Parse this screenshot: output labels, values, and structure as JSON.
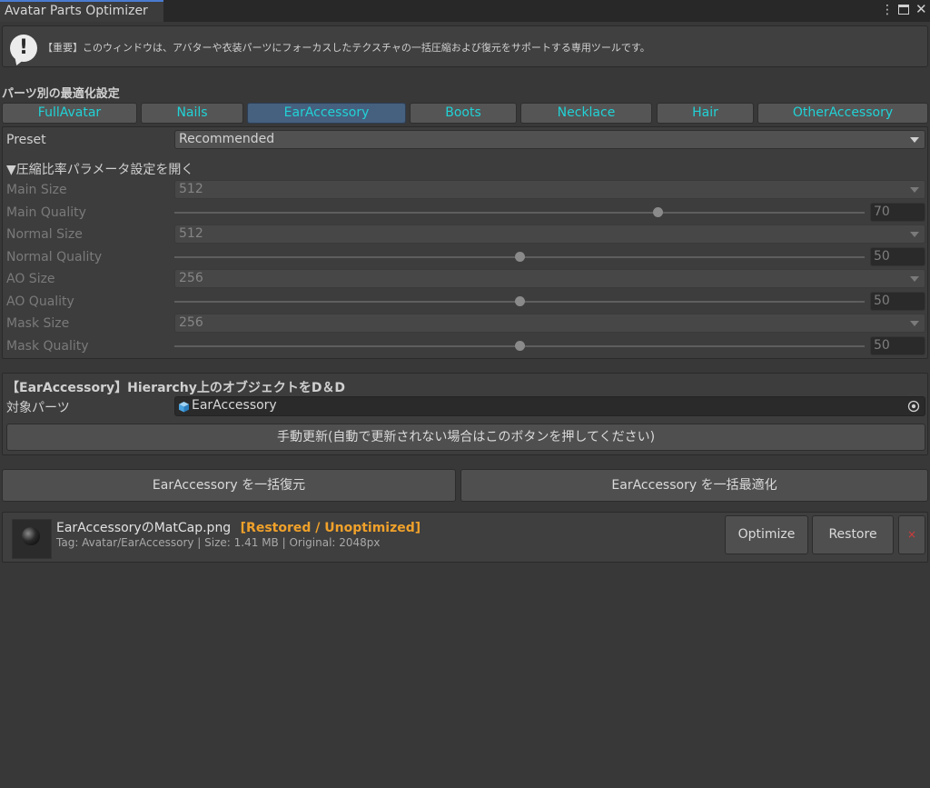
{
  "window": {
    "title": "Avatar Parts Optimizer"
  },
  "help": {
    "text": "【重要】このウィンドウは、アバターや衣装パーツにフォーカスしたテクスチャの一括圧縮および復元をサポートする専用ツールです。"
  },
  "section": {
    "title": "パーツ別の最適化設定"
  },
  "tabs": [
    {
      "label": "FullAvatar"
    },
    {
      "label": "Nails"
    },
    {
      "label": "EarAccessory"
    },
    {
      "label": "Boots"
    },
    {
      "label": "Necklace"
    },
    {
      "label": "Hair"
    },
    {
      "label": "OtherAccessory"
    }
  ],
  "selected_tab": "EarAccessory",
  "params": {
    "preset_label": "Preset",
    "preset_value": "Recommended",
    "foldout_label": "▼圧縮比率パラメータ設定を開く",
    "main_size_label": "Main Size",
    "main_size": "512",
    "main_quality_label": "Main Quality",
    "main_quality": "70",
    "normal_size_label": "Normal Size",
    "normal_size": "512",
    "normal_quality_label": "Normal Quality",
    "normal_quality": "50",
    "ao_size_label": "AO Size",
    "ao_size": "256",
    "ao_quality_label": "AO Quality",
    "ao_quality": "50",
    "mask_size_label": "Mask Size",
    "mask_size": "256",
    "mask_quality_label": "Mask Quality",
    "mask_quality": "50",
    "slider_range": [
      0,
      100
    ]
  },
  "object_section": {
    "title": "【EarAccessory】Hierarchy上のオブジェクトをD＆D",
    "target_label": "対象パーツ",
    "target_value": "EarAccessory",
    "refresh_button": "手動更新(自動で更新されない場合はこのボタンを押してください)"
  },
  "actions": {
    "restore_all": "EarAccessory を一括復元",
    "optimize_all": "EarAccessory を一括最適化"
  },
  "results": [
    {
      "filename": "EarAccessoryのMatCap.png",
      "status": "[Restored / Unoptimized]",
      "meta": "Tag: Avatar/EarAccessory | Size: 1.41 MB | Original: 2048px",
      "optimize_label": "Optimize",
      "restore_label": "Restore",
      "delete_label": "×"
    }
  ],
  "colors": {
    "tab_text": "#21d2d6",
    "active_tab": "#46607f",
    "status": "#f0a12a",
    "delete": "#d33a3a"
  },
  "icons": {
    "help": "exclamation-bubble-icon",
    "menu": "kebab-menu-icon",
    "maximize": "maximize-icon",
    "close": "close-icon",
    "object": "gameobject-cube-icon",
    "picker": "object-picker-icon"
  }
}
